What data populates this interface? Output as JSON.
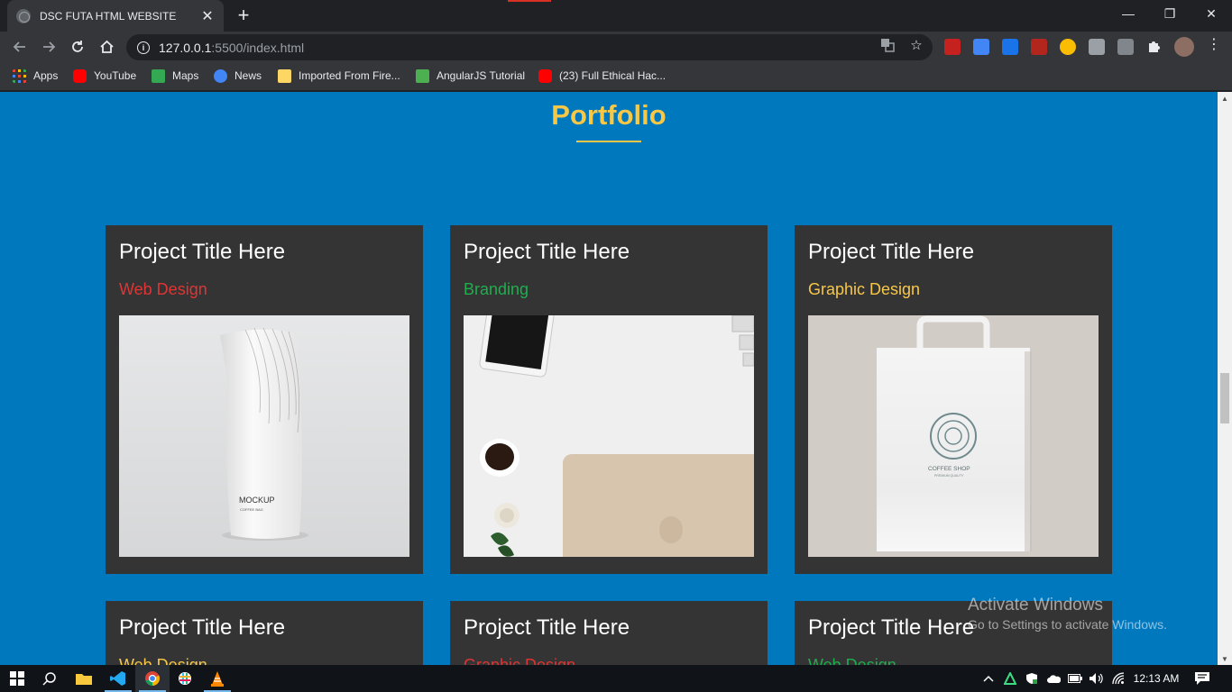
{
  "browser": {
    "tab_title": "DSC FUTA HTML WEBSITE",
    "tab_close": "✕",
    "new_tab": "+",
    "url_host": "127.0.0.1",
    "url_path": ":5500/index.html",
    "window_controls": {
      "minimize": "—",
      "maximize": "❐",
      "close": "✕"
    }
  },
  "bookmarks": [
    {
      "label": "Apps",
      "icon": "apps-grid-icon",
      "color": "#ea4335"
    },
    {
      "label": "YouTube",
      "icon": "youtube-icon",
      "color": "#ff0000"
    },
    {
      "label": "Maps",
      "icon": "maps-icon",
      "color": "#34a853"
    },
    {
      "label": "News",
      "icon": "news-icon",
      "color": "#4285f4"
    },
    {
      "label": "Imported From Fire...",
      "icon": "folder-icon",
      "color": "#fdd663"
    },
    {
      "label": "AngularJS Tutorial",
      "icon": "w3schools-icon",
      "color": "#4caf50"
    },
    {
      "label": "(23) Full Ethical Hac...",
      "icon": "youtube-icon",
      "color": "#ff0000"
    }
  ],
  "page": {
    "section_title": "Portfolio",
    "projects": [
      {
        "title": "Project Title Here",
        "category": "Web Design",
        "category_color": "#e03434",
        "image": "coffee-pouch-mockup"
      },
      {
        "title": "Project Title Here",
        "category": "Branding",
        "category_color": "#1fae4e",
        "image": "desk-flatlay"
      },
      {
        "title": "Project Title Here",
        "category": "Graphic Design",
        "category_color": "#f7c747",
        "image": "shopping-bag-mockup"
      },
      {
        "title": "Project Title Here",
        "category": "Web Design",
        "category_color": "#f7c747"
      },
      {
        "title": "Project Title Here",
        "category": "Graphic Design",
        "category_color": "#e03434"
      },
      {
        "title": "Project Title Here",
        "category": "Web Design",
        "category_color": "#1fae4e"
      }
    ],
    "mockup_text": {
      "pouch_brand": "MOCKUP",
      "pouch_sub": "COFFEE BAG",
      "bag_brand": "COFFEE SHOP",
      "bag_sub": "PREMIUM QUALITY"
    }
  },
  "watermark": {
    "title": "Activate Windows",
    "subtitle": "Go to Settings to activate Windows."
  },
  "taskbar": {
    "time": "12:13 AM",
    "apps": [
      "windows-start-icon",
      "search-icon",
      "file-explorer-icon",
      "vscode-icon",
      "chrome-icon",
      "slack-icon",
      "vlc-icon"
    ]
  },
  "colors": {
    "page_bg": "#0078be",
    "card_bg": "#343434",
    "accent_yellow": "#f7c747",
    "accent_red": "#e03434",
    "accent_green": "#1fae4e"
  }
}
